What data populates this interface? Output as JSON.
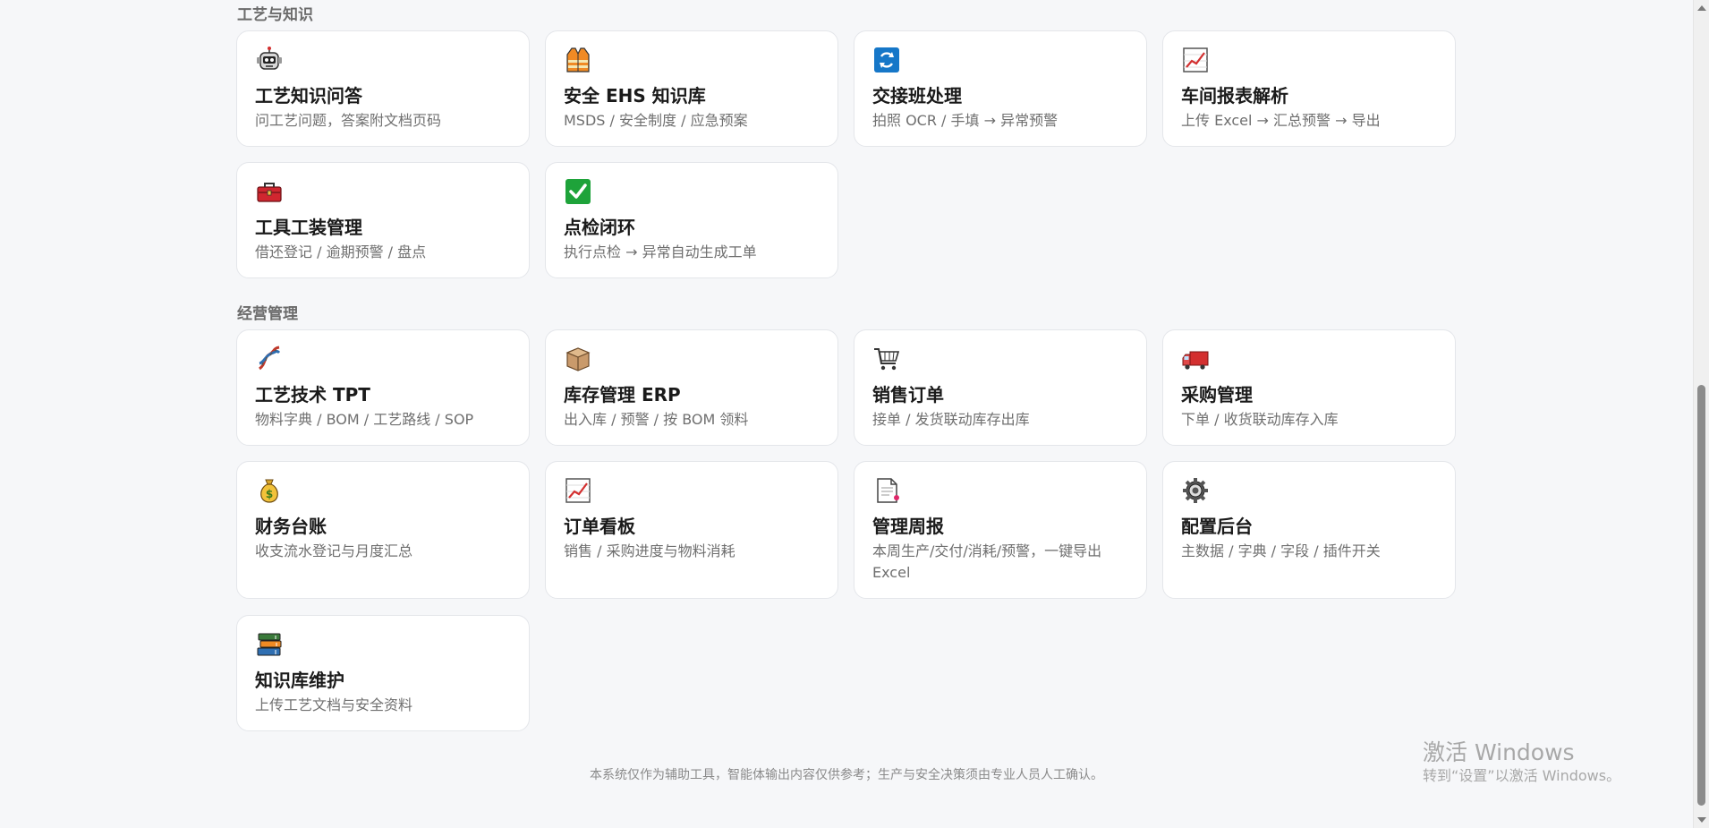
{
  "sections": {
    "process": {
      "title": "工艺与知识"
    },
    "management": {
      "title": "经营管理"
    }
  },
  "cards": [
    {
      "title": "工艺知识问答",
      "desc": "问工艺问题，答案附文档页码",
      "icon": "robot-icon"
    },
    {
      "title": "安全 EHS 知识库",
      "desc": "MSDS / 安全制度 / 应急预案",
      "icon": "safety-vest-icon"
    },
    {
      "title": "交接班处理",
      "desc": "拍照 OCR / 手填 → 异常预警",
      "icon": "refresh-icon"
    },
    {
      "title": "车间报表解析",
      "desc": "上传 Excel → 汇总预警 → 导出",
      "icon": "chart-up-icon"
    },
    {
      "title": "工具工装管理",
      "desc": "借还登记 / 逾期预警 / 盘点",
      "icon": "toolbox-icon"
    },
    {
      "title": "点检闭环",
      "desc": "执行点检 → 异常自动生成工单",
      "icon": "check-icon"
    },
    {
      "title": "工艺技术 TPT",
      "desc": "物料字典 / BOM / 工艺路线 / SOP",
      "icon": "dna-icon"
    },
    {
      "title": "库存管理 ERP",
      "desc": "出入库 / 预警 / 按 BOM 领料",
      "icon": "package-icon"
    },
    {
      "title": "销售订单",
      "desc": "接单 / 发货联动库存出库",
      "icon": "cart-icon"
    },
    {
      "title": "采购管理",
      "desc": "下单 / 收货联动库存入库",
      "icon": "truck-icon"
    },
    {
      "title": "财务台账",
      "desc": "收支流水登记与月度汇总",
      "icon": "money-bag-icon"
    },
    {
      "title": "订单看板",
      "desc": "销售 / 采购进度与物料消耗",
      "icon": "chart-up-icon"
    },
    {
      "title": "管理周报",
      "desc": "本周生产/交付/消耗/预警，一键导出 Excel",
      "icon": "document-icon"
    },
    {
      "title": "配置后台",
      "desc": "主数据 / 字典 / 字段 / 插件开关",
      "icon": "gear-icon"
    },
    {
      "title": "知识库维护",
      "desc": "上传工艺文档与安全资料",
      "icon": "books-icon"
    }
  ],
  "footer": {
    "note": "本系统仅作为辅助工具，智能体输出内容仅供参考；生产与安全决策须由专业人员人工确认。"
  },
  "watermark": {
    "line1": "激活 Windows",
    "line2": "转到“设置”以激活 Windows。"
  },
  "colors": {
    "background": "#f6f7f9",
    "card": "#ffffff",
    "card_border": "#e4e6ea",
    "accent_blue": "#1677c8",
    "accent_red": "#d32f2f"
  }
}
